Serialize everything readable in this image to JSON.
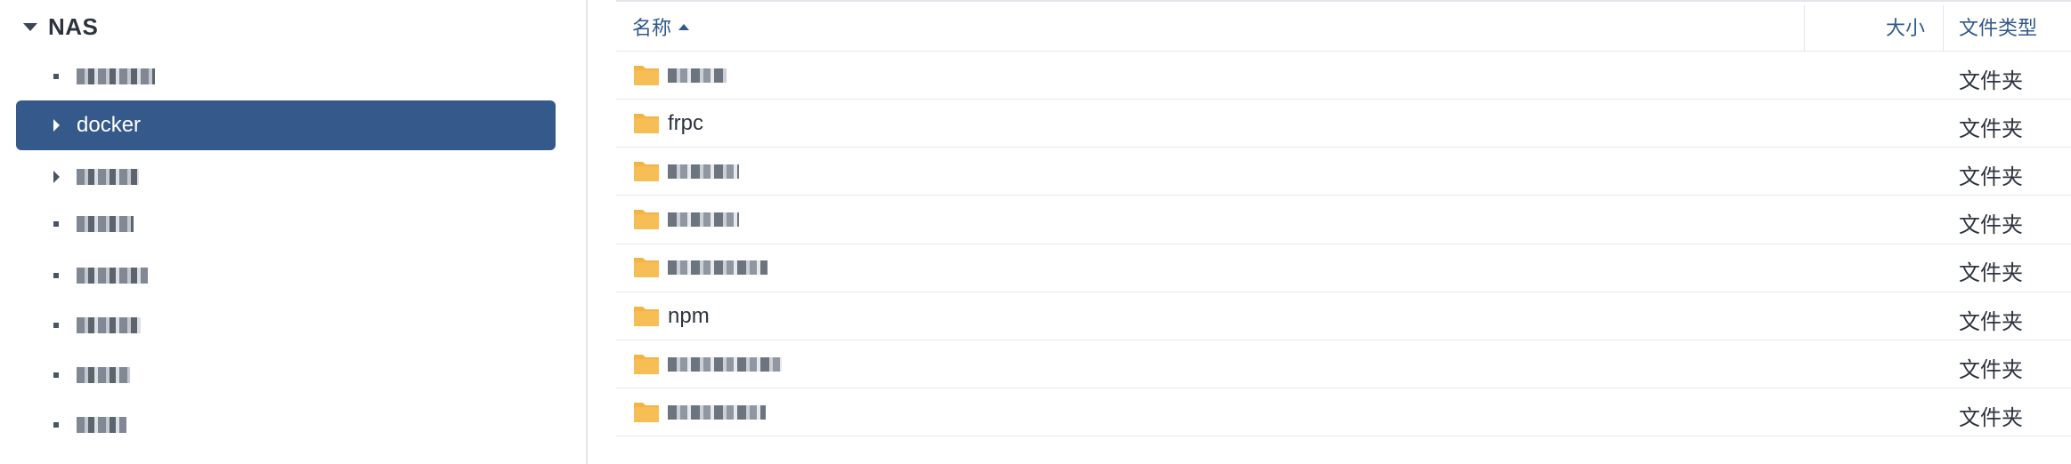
{
  "tree": {
    "root_label": "NAS",
    "items": [
      {
        "label": "",
        "redacted": true
      },
      {
        "label": "docker",
        "redacted": false,
        "selected": true
      },
      {
        "label": "",
        "redacted": true
      },
      {
        "label": "",
        "redacted": true
      },
      {
        "label": "",
        "redacted": true
      },
      {
        "label": "",
        "redacted": true
      },
      {
        "label": "",
        "redacted": true
      },
      {
        "label": "",
        "redacted": true
      }
    ]
  },
  "table": {
    "columns": {
      "name": "名称",
      "size": "大小",
      "type": "文件类型"
    },
    "rows": [
      {
        "name": "",
        "redacted": true,
        "type": "文件夹"
      },
      {
        "name": "frpc",
        "redacted": false,
        "type": "文件夹"
      },
      {
        "name": "",
        "redacted": true,
        "type": "文件夹"
      },
      {
        "name": "",
        "redacted": true,
        "type": "文件夹"
      },
      {
        "name": "",
        "redacted": true,
        "type": "文件夹"
      },
      {
        "name": "npm",
        "redacted": false,
        "type": "文件夹"
      },
      {
        "name": "",
        "redacted": true,
        "type": "文件夹"
      },
      {
        "name": "",
        "redacted": true,
        "type": "文件夹"
      }
    ]
  },
  "colors": {
    "selection": "#35598a",
    "header_text": "#2f5a8c",
    "folder": "#f5b342"
  }
}
